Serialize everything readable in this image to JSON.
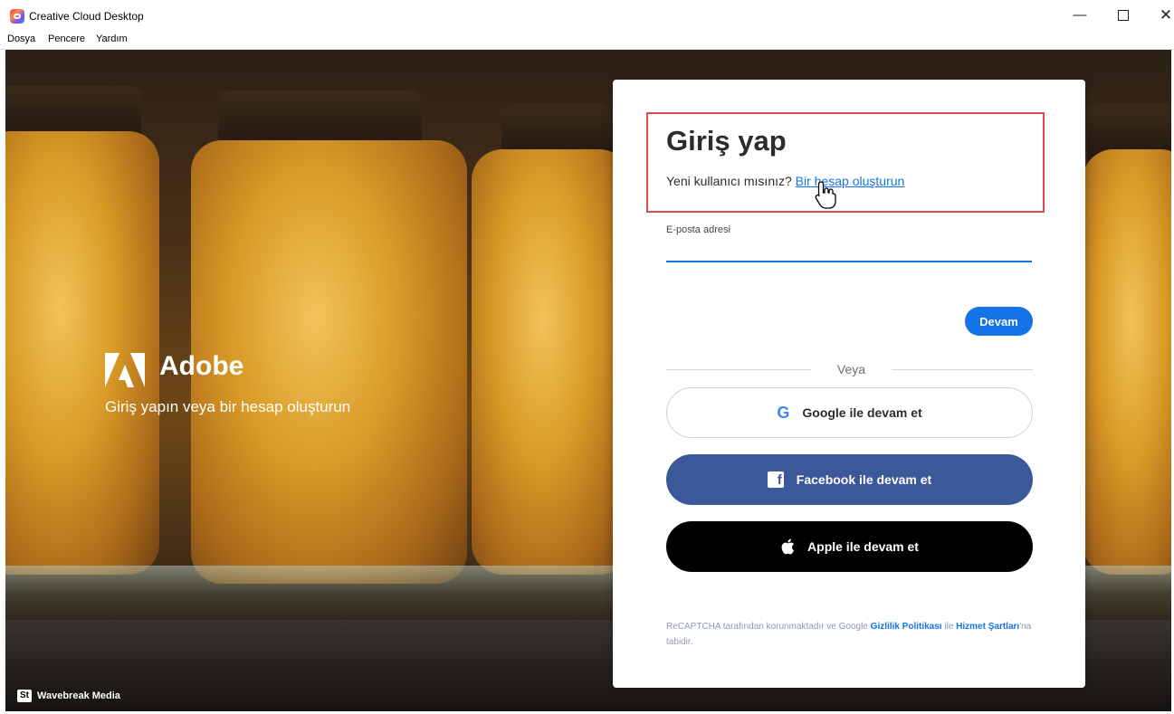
{
  "window": {
    "title": "Creative Cloud Desktop",
    "controls": {
      "minimize": "—",
      "maximize": "□",
      "close": "✕"
    }
  },
  "menubar": {
    "items": [
      "Dosya",
      "Pencere",
      "Yardım"
    ]
  },
  "hero": {
    "brand_name": "Adobe",
    "tagline": "Giriş yapın veya bir hesap oluşturun",
    "photo_credit": "Wavebreak Media",
    "credit_badge": "St"
  },
  "signin": {
    "heading": "Giriş yap",
    "new_user_prompt": "Yeni kullanıcı mısınız? ",
    "create_account_link": "Bir hesap oluşturun",
    "email_label": "E-posta adresi",
    "email_value": "",
    "continue_button": "Devam",
    "or_divider": "Veya",
    "google_button": "Google ile devam et",
    "facebook_button": "Facebook ile devam et",
    "apple_button": "Apple ile devam et",
    "google_icon_glyph": "G",
    "facebook_icon_glyph": "f",
    "legal_prefix": "ReCAPTCHA tarafından korunmaktadır ve Google ",
    "privacy_link": "Gizlilik Politikası",
    "legal_middle": " ile ",
    "terms_link": "Hizmet Şartları",
    "legal_suffix": "'na tabidir."
  },
  "colors": {
    "accent_blue": "#1473e6",
    "facebook_blue": "#3b5998",
    "highlight_red": "#e04a52"
  },
  "icons": {
    "app": "creative-cloud-icon",
    "logo": "adobe-logo-icon",
    "google": "google-icon",
    "facebook": "facebook-icon",
    "apple": "apple-icon",
    "cursor": "hand-pointer-icon"
  }
}
